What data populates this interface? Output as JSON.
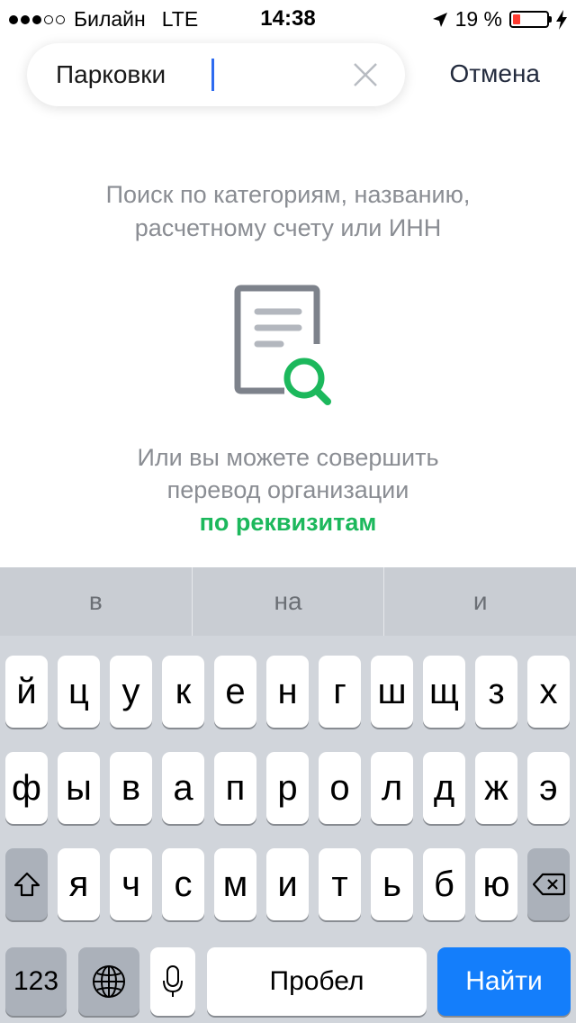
{
  "status_bar": {
    "carrier": "Билайн",
    "network": "LTE",
    "time": "14:38",
    "battery": "19 %",
    "battery_color": "#ff3b30"
  },
  "search": {
    "value": "Парковки",
    "cancel_label": "Отмена"
  },
  "hint": {
    "line1": "Поиск по категориям, названию,",
    "line2": "расчетному счету или ИНН"
  },
  "alternative": {
    "line1": "Или вы можете совершить",
    "line2": "перевод организации",
    "link": "по реквизитам",
    "link_color": "#1cb85c"
  },
  "suggestions": [
    "в",
    "на",
    "и"
  ],
  "keyboard": {
    "row1": [
      "й",
      "ц",
      "у",
      "к",
      "е",
      "н",
      "г",
      "ш",
      "щ",
      "з",
      "х"
    ],
    "row2": [
      "ф",
      "ы",
      "в",
      "а",
      "п",
      "р",
      "о",
      "л",
      "д",
      "ж",
      "э"
    ],
    "row3": [
      "я",
      "ч",
      "с",
      "м",
      "и",
      "т",
      "ь",
      "б",
      "ю"
    ],
    "numbers_label": "123",
    "space_label": "Пробел",
    "return_label": "Найти",
    "return_color": "#147efb"
  }
}
